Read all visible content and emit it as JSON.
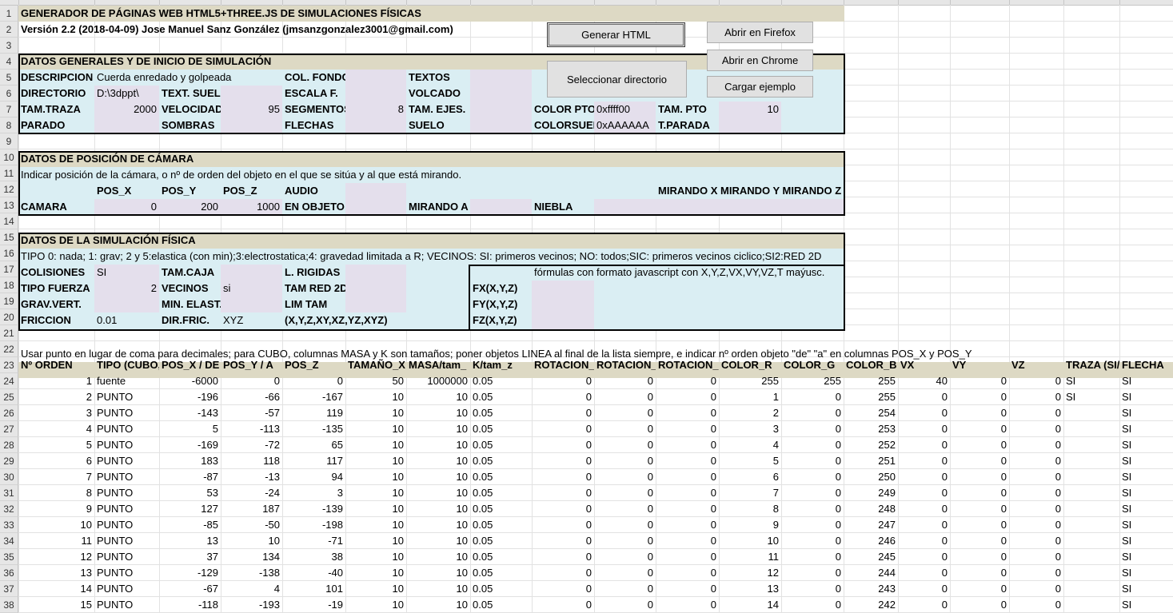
{
  "rows": [
    "1",
    "2",
    "3",
    "4",
    "5",
    "6",
    "7",
    "8",
    "9",
    "10",
    "11",
    "12",
    "13",
    "14",
    "15",
    "16",
    "17",
    "18",
    "19",
    "20",
    "21",
    "22",
    "23",
    "24",
    "25",
    "26",
    "27",
    "28",
    "29",
    "30",
    "31",
    "32",
    "33",
    "34",
    "35",
    "36",
    "37",
    "38"
  ],
  "header": {
    "title": "GENERADOR DE PÁGINAS WEB HTML5+THREE.JS DE SIMULACIONES FÍSICAS",
    "version": "Versión 2.2 (2018-04-09) Jose Manuel Sanz González (jmsanzgonzalez3001@gmail.com)"
  },
  "buttons": {
    "generar": "Generar HTML",
    "firefox": "Abrir en Firefox",
    "chrome": "Abrir en Chrome",
    "seleccionar": "Seleccionar directorio",
    "cargar": "Cargar ejemplo"
  },
  "general": {
    "title": "DATOS GENERALES Y DE INICIO DE SIMULACIÓN",
    "descripcion_label": "DESCRIPCION",
    "descripcion": "Cuerda enredado y golpeada",
    "col_fondo_label": "COL. FONDO",
    "textos_label": "TEXTOS",
    "directorio_label": "DIRECTORIO",
    "directorio": "D:\\3dppt\\",
    "text_suelo_label": "TEXT. SUELO",
    "escala_label": "ESCALA F.",
    "volcado_label": "VOLCADO",
    "tam_traza_label": "TAM.TRAZA",
    "tam_traza": "2000",
    "velocidad_label": "VELOCIDAD",
    "velocidad": "95",
    "segmentos_label": "SEGMENTOS",
    "segmentos": "8",
    "tam_ejes_label": "TAM. EJES.",
    "color_pto_label": "COLOR PTO",
    "color_pto": "0xffff00",
    "tam_pto_label": "TAM. PTO",
    "tam_pto": "10",
    "parado_label": "PARADO",
    "sombras_label": "SOMBRAS",
    "flechas_label": "FLECHAS",
    "suelo_label": "SUELO",
    "colorsuelo_label": "COLORSUELO",
    "colorsuelo": "0xAAAAAA",
    "tparada_label": "T.PARADA"
  },
  "camera": {
    "title": "DATOS DE POSICIÓN DE CÁMARA",
    "note": "Indicar posición de la cámara, o nº de orden del objeto en el que se sitúa y al que está mirando.",
    "pos_x_label": "POS_X",
    "pos_y_label": "POS_Y",
    "pos_z_label": "POS_Z",
    "audio_label": "AUDIO",
    "mirando_xyz": "MIRANDO X MIRANDO Y MIRANDO Z",
    "camara_label": "CAMARA",
    "pos_x": "0",
    "pos_y": "200",
    "pos_z": "1000",
    "en_objeto_label": "EN OBJETO",
    "mirando_a_label": "MIRANDO A",
    "niebla_label": "NIEBLA"
  },
  "physics": {
    "title": "DATOS DE LA SIMULACIÓN FÍSICA",
    "note": "TIPO 0: nada; 1: grav; 2 y 5:elastica (con min);3:electrostatica;4: gravedad limitada a R; VECINOS: SI: primeros vecinos; NO: todos;SIC: primeros vecinos ciclico;SI2:RED 2D",
    "colisiones_label": "COLISIONES",
    "colisiones": "SI",
    "tam_caja_label": "TAM.CAJA",
    "l_rigidas_label": "L. RIGIDAS",
    "formulas_note": "fórmulas con formato javascript con X,Y,Z,VX,VY,VZ,T maýusc.",
    "tipo_fuerza_label": "TIPO FUERZA",
    "tipo_fuerza": "2",
    "vecinos_label": "VECINOS",
    "vecinos": "si",
    "tam_red_label": "TAM RED 2D",
    "fx_label": "FX(X,Y,Z)",
    "grav_vert_label": "GRAV.VERT.",
    "min_elast_label": "MIN. ELAST.",
    "lim_tam_label": "LIM TAM",
    "fy_label": "FY(X,Y,Z)",
    "friccion_label": "FRICCION",
    "friccion": "0.01",
    "dir_fric_label": "DIR.FRIC.",
    "dir_fric": "XYZ",
    "xyz_opts": "(X,Y,Z,XY,XZ,YZ,XYZ)",
    "fz_label": "FZ(X,Y,Z)"
  },
  "list_note": "Usar punto en lugar de coma para decimales; para CUBO, columnas MASA y K son tamaños; poner objetos LINEA al final de la lista siempre, e indicar nº orden objeto \"de\" \"a\" en columnas POS_X y POS_Y",
  "table": {
    "headers": [
      "Nº ORDEN",
      "TIPO (CUBO,",
      "POS_X / DE",
      "POS_Y / A",
      "POS_Z",
      "TAMAÑO_X",
      "MASA/tam_",
      "K/tam_z",
      "ROTACION_X",
      "ROTACION_Y",
      "ROTACION_Z",
      "COLOR_R",
      "COLOR_G",
      "COLOR_B",
      "VX",
      "VY",
      "VZ",
      "TRAZA (SI/",
      "FLECHA"
    ],
    "rows": [
      [
        "1",
        "fuente",
        "-6000",
        "0",
        "0",
        "50",
        "1000000",
        "0.05",
        "0",
        "0",
        "0",
        "255",
        "255",
        "255",
        "40",
        "0",
        "0",
        "SI",
        "SI"
      ],
      [
        "2",
        "PUNTO",
        "-196",
        "-66",
        "-167",
        "10",
        "10",
        "0.05",
        "0",
        "0",
        "0",
        "1",
        "0",
        "255",
        "0",
        "0",
        "0",
        "SI",
        "SI"
      ],
      [
        "3",
        "PUNTO",
        "-143",
        "-57",
        "119",
        "10",
        "10",
        "0.05",
        "0",
        "0",
        "0",
        "2",
        "0",
        "254",
        "0",
        "0",
        "0",
        "",
        "SI"
      ],
      [
        "4",
        "PUNTO",
        "5",
        "-113",
        "-135",
        "10",
        "10",
        "0.05",
        "0",
        "0",
        "0",
        "3",
        "0",
        "253",
        "0",
        "0",
        "0",
        "",
        "SI"
      ],
      [
        "5",
        "PUNTO",
        "-169",
        "-72",
        "65",
        "10",
        "10",
        "0.05",
        "0",
        "0",
        "0",
        "4",
        "0",
        "252",
        "0",
        "0",
        "0",
        "",
        "SI"
      ],
      [
        "6",
        "PUNTO",
        "183",
        "118",
        "117",
        "10",
        "10",
        "0.05",
        "0",
        "0",
        "0",
        "5",
        "0",
        "251",
        "0",
        "0",
        "0",
        "",
        "SI"
      ],
      [
        "7",
        "PUNTO",
        "-87",
        "-13",
        "94",
        "10",
        "10",
        "0.05",
        "0",
        "0",
        "0",
        "6",
        "0",
        "250",
        "0",
        "0",
        "0",
        "",
        "SI"
      ],
      [
        "8",
        "PUNTO",
        "53",
        "-24",
        "3",
        "10",
        "10",
        "0.05",
        "0",
        "0",
        "0",
        "7",
        "0",
        "249",
        "0",
        "0",
        "0",
        "",
        "SI"
      ],
      [
        "9",
        "PUNTO",
        "127",
        "187",
        "-139",
        "10",
        "10",
        "0.05",
        "0",
        "0",
        "0",
        "8",
        "0",
        "248",
        "0",
        "0",
        "0",
        "",
        "SI"
      ],
      [
        "10",
        "PUNTO",
        "-85",
        "-50",
        "-198",
        "10",
        "10",
        "0.05",
        "0",
        "0",
        "0",
        "9",
        "0",
        "247",
        "0",
        "0",
        "0",
        "",
        "SI"
      ],
      [
        "11",
        "PUNTO",
        "13",
        "10",
        "-71",
        "10",
        "10",
        "0.05",
        "0",
        "0",
        "0",
        "10",
        "0",
        "246",
        "0",
        "0",
        "0",
        "",
        "SI"
      ],
      [
        "12",
        "PUNTO",
        "37",
        "134",
        "38",
        "10",
        "10",
        "0.05",
        "0",
        "0",
        "0",
        "11",
        "0",
        "245",
        "0",
        "0",
        "0",
        "",
        "SI"
      ],
      [
        "13",
        "PUNTO",
        "-129",
        "-138",
        "-40",
        "10",
        "10",
        "0.05",
        "0",
        "0",
        "0",
        "12",
        "0",
        "244",
        "0",
        "0",
        "0",
        "",
        "SI"
      ],
      [
        "14",
        "PUNTO",
        "-67",
        "4",
        "101",
        "10",
        "10",
        "0.05",
        "0",
        "0",
        "0",
        "13",
        "0",
        "243",
        "0",
        "0",
        "0",
        "",
        "SI"
      ],
      [
        "15",
        "PUNTO",
        "-118",
        "-193",
        "-19",
        "10",
        "10",
        "0.05",
        "0",
        "0",
        "0",
        "14",
        "0",
        "242",
        "0",
        "0",
        "0",
        "",
        "SI"
      ]
    ]
  },
  "colors": {
    "title_band": "#ddd9c4",
    "light_blue": "#daeef3",
    "lavender": "#e4dfec",
    "button": "#e1e1e1"
  }
}
